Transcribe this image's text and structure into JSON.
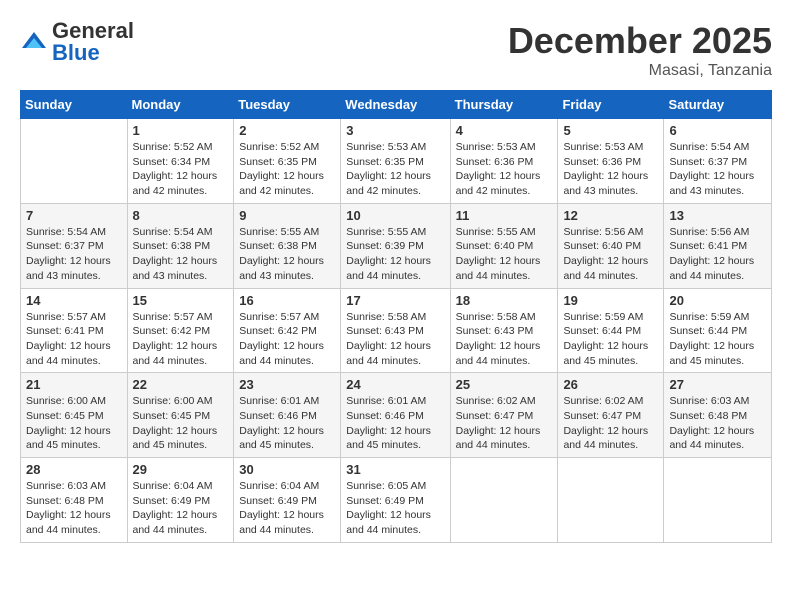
{
  "logo": {
    "general": "General",
    "blue": "Blue"
  },
  "title": "December 2025",
  "location": "Masasi, Tanzania",
  "days_of_week": [
    "Sunday",
    "Monday",
    "Tuesday",
    "Wednesday",
    "Thursday",
    "Friday",
    "Saturday"
  ],
  "weeks": [
    [
      {
        "day": "",
        "sunrise": "",
        "sunset": "",
        "daylight": ""
      },
      {
        "day": "1",
        "sunrise": "Sunrise: 5:52 AM",
        "sunset": "Sunset: 6:34 PM",
        "daylight": "Daylight: 12 hours and 42 minutes."
      },
      {
        "day": "2",
        "sunrise": "Sunrise: 5:52 AM",
        "sunset": "Sunset: 6:35 PM",
        "daylight": "Daylight: 12 hours and 42 minutes."
      },
      {
        "day": "3",
        "sunrise": "Sunrise: 5:53 AM",
        "sunset": "Sunset: 6:35 PM",
        "daylight": "Daylight: 12 hours and 42 minutes."
      },
      {
        "day": "4",
        "sunrise": "Sunrise: 5:53 AM",
        "sunset": "Sunset: 6:36 PM",
        "daylight": "Daylight: 12 hours and 42 minutes."
      },
      {
        "day": "5",
        "sunrise": "Sunrise: 5:53 AM",
        "sunset": "Sunset: 6:36 PM",
        "daylight": "Daylight: 12 hours and 43 minutes."
      },
      {
        "day": "6",
        "sunrise": "Sunrise: 5:54 AM",
        "sunset": "Sunset: 6:37 PM",
        "daylight": "Daylight: 12 hours and 43 minutes."
      }
    ],
    [
      {
        "day": "7",
        "sunrise": "Sunrise: 5:54 AM",
        "sunset": "Sunset: 6:37 PM",
        "daylight": "Daylight: 12 hours and 43 minutes."
      },
      {
        "day": "8",
        "sunrise": "Sunrise: 5:54 AM",
        "sunset": "Sunset: 6:38 PM",
        "daylight": "Daylight: 12 hours and 43 minutes."
      },
      {
        "day": "9",
        "sunrise": "Sunrise: 5:55 AM",
        "sunset": "Sunset: 6:38 PM",
        "daylight": "Daylight: 12 hours and 43 minutes."
      },
      {
        "day": "10",
        "sunrise": "Sunrise: 5:55 AM",
        "sunset": "Sunset: 6:39 PM",
        "daylight": "Daylight: 12 hours and 44 minutes."
      },
      {
        "day": "11",
        "sunrise": "Sunrise: 5:55 AM",
        "sunset": "Sunset: 6:40 PM",
        "daylight": "Daylight: 12 hours and 44 minutes."
      },
      {
        "day": "12",
        "sunrise": "Sunrise: 5:56 AM",
        "sunset": "Sunset: 6:40 PM",
        "daylight": "Daylight: 12 hours and 44 minutes."
      },
      {
        "day": "13",
        "sunrise": "Sunrise: 5:56 AM",
        "sunset": "Sunset: 6:41 PM",
        "daylight": "Daylight: 12 hours and 44 minutes."
      }
    ],
    [
      {
        "day": "14",
        "sunrise": "Sunrise: 5:57 AM",
        "sunset": "Sunset: 6:41 PM",
        "daylight": "Daylight: 12 hours and 44 minutes."
      },
      {
        "day": "15",
        "sunrise": "Sunrise: 5:57 AM",
        "sunset": "Sunset: 6:42 PM",
        "daylight": "Daylight: 12 hours and 44 minutes."
      },
      {
        "day": "16",
        "sunrise": "Sunrise: 5:57 AM",
        "sunset": "Sunset: 6:42 PM",
        "daylight": "Daylight: 12 hours and 44 minutes."
      },
      {
        "day": "17",
        "sunrise": "Sunrise: 5:58 AM",
        "sunset": "Sunset: 6:43 PM",
        "daylight": "Daylight: 12 hours and 44 minutes."
      },
      {
        "day": "18",
        "sunrise": "Sunrise: 5:58 AM",
        "sunset": "Sunset: 6:43 PM",
        "daylight": "Daylight: 12 hours and 44 minutes."
      },
      {
        "day": "19",
        "sunrise": "Sunrise: 5:59 AM",
        "sunset": "Sunset: 6:44 PM",
        "daylight": "Daylight: 12 hours and 45 minutes."
      },
      {
        "day": "20",
        "sunrise": "Sunrise: 5:59 AM",
        "sunset": "Sunset: 6:44 PM",
        "daylight": "Daylight: 12 hours and 45 minutes."
      }
    ],
    [
      {
        "day": "21",
        "sunrise": "Sunrise: 6:00 AM",
        "sunset": "Sunset: 6:45 PM",
        "daylight": "Daylight: 12 hours and 45 minutes."
      },
      {
        "day": "22",
        "sunrise": "Sunrise: 6:00 AM",
        "sunset": "Sunset: 6:45 PM",
        "daylight": "Daylight: 12 hours and 45 minutes."
      },
      {
        "day": "23",
        "sunrise": "Sunrise: 6:01 AM",
        "sunset": "Sunset: 6:46 PM",
        "daylight": "Daylight: 12 hours and 45 minutes."
      },
      {
        "day": "24",
        "sunrise": "Sunrise: 6:01 AM",
        "sunset": "Sunset: 6:46 PM",
        "daylight": "Daylight: 12 hours and 45 minutes."
      },
      {
        "day": "25",
        "sunrise": "Sunrise: 6:02 AM",
        "sunset": "Sunset: 6:47 PM",
        "daylight": "Daylight: 12 hours and 44 minutes."
      },
      {
        "day": "26",
        "sunrise": "Sunrise: 6:02 AM",
        "sunset": "Sunset: 6:47 PM",
        "daylight": "Daylight: 12 hours and 44 minutes."
      },
      {
        "day": "27",
        "sunrise": "Sunrise: 6:03 AM",
        "sunset": "Sunset: 6:48 PM",
        "daylight": "Daylight: 12 hours and 44 minutes."
      }
    ],
    [
      {
        "day": "28",
        "sunrise": "Sunrise: 6:03 AM",
        "sunset": "Sunset: 6:48 PM",
        "daylight": "Daylight: 12 hours and 44 minutes."
      },
      {
        "day": "29",
        "sunrise": "Sunrise: 6:04 AM",
        "sunset": "Sunset: 6:49 PM",
        "daylight": "Daylight: 12 hours and 44 minutes."
      },
      {
        "day": "30",
        "sunrise": "Sunrise: 6:04 AM",
        "sunset": "Sunset: 6:49 PM",
        "daylight": "Daylight: 12 hours and 44 minutes."
      },
      {
        "day": "31",
        "sunrise": "Sunrise: 6:05 AM",
        "sunset": "Sunset: 6:49 PM",
        "daylight": "Daylight: 12 hours and 44 minutes."
      },
      {
        "day": "",
        "sunrise": "",
        "sunset": "",
        "daylight": ""
      },
      {
        "day": "",
        "sunrise": "",
        "sunset": "",
        "daylight": ""
      },
      {
        "day": "",
        "sunrise": "",
        "sunset": "",
        "daylight": ""
      }
    ]
  ]
}
